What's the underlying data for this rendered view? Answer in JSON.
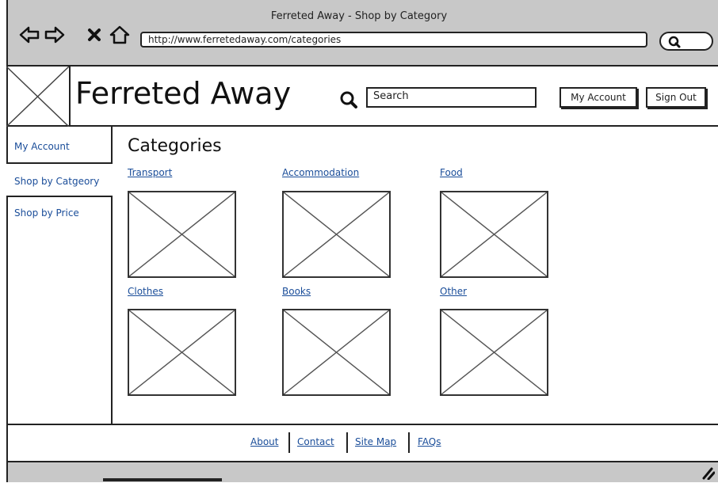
{
  "browser": {
    "window_title": "Ferreted Away - Shop by Category",
    "url": "http://www.ferretedaway.com/categories",
    "icons": [
      "back-arrow-icon",
      "forward-arrow-icon",
      "close-icon",
      "home-icon",
      "search-icon"
    ]
  },
  "header": {
    "site_title": "Ferreted Away",
    "search_placeholder": "Search",
    "my_account_label": "My Account",
    "sign_out_label": "Sign Out"
  },
  "sidebar": {
    "items": [
      {
        "label": "My Account"
      },
      {
        "label": "Shop by Catgeory"
      },
      {
        "label": "Shop by Price"
      }
    ]
  },
  "main": {
    "title": "Categories",
    "categories": [
      {
        "label": "Transport"
      },
      {
        "label": "Accommodation"
      },
      {
        "label": "Food"
      },
      {
        "label": "Clothes"
      },
      {
        "label": "Books"
      },
      {
        "label": "Other"
      }
    ]
  },
  "footer": {
    "links": [
      {
        "label": "About"
      },
      {
        "label": "Contact"
      },
      {
        "label": "Site Map"
      },
      {
        "label": "FAQs"
      }
    ]
  }
}
